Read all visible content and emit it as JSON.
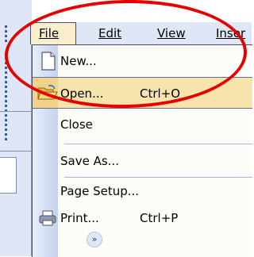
{
  "menubar": {
    "items": [
      "File",
      "Edit",
      "View",
      "Inser"
    ],
    "underline": [
      "F",
      "E",
      "V",
      "I"
    ]
  },
  "file_menu": {
    "new_label": "New...",
    "open_label": "Open...",
    "open_shortcut": "Ctrl+O",
    "close_label": "Close",
    "save_as_label": "Save As...",
    "page_setup_label": "Page Setup...",
    "print_label": "Print...",
    "print_shortcut": "Ctrl+P",
    "expand_glyph": "»"
  },
  "icons": {
    "new": "new-document-icon",
    "open": "open-folder-icon",
    "print": "printer-icon",
    "expand": "expand-chevron-icon"
  },
  "colors": {
    "highlight": "#f7e4ad",
    "annotation": "#e60000",
    "toolbar": "#dfe6f5"
  }
}
